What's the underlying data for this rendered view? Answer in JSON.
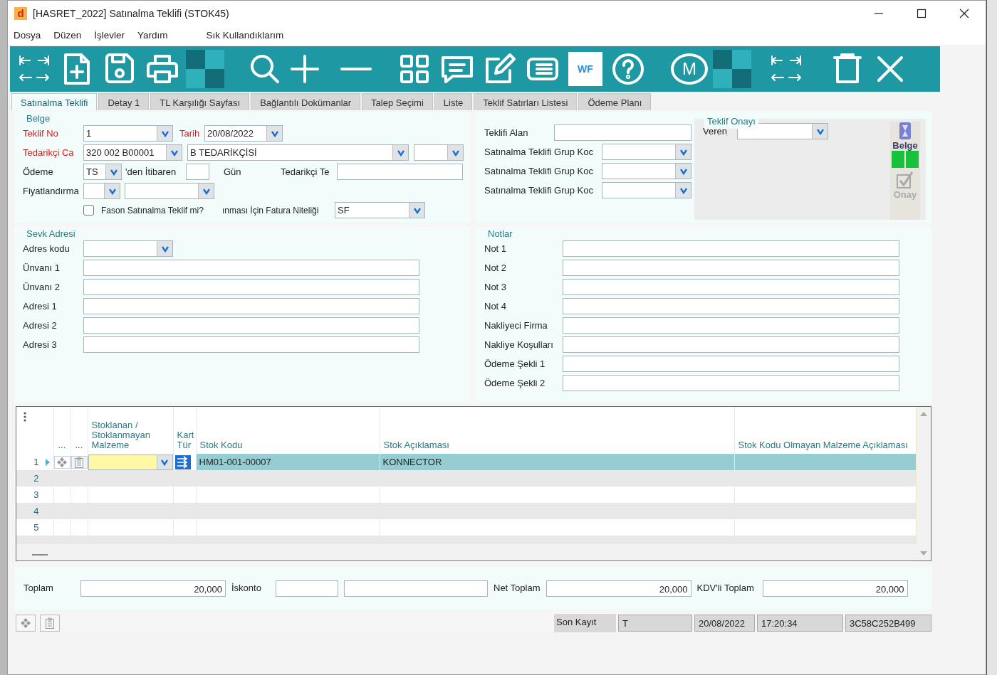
{
  "window": {
    "logo": "d",
    "title": "[HASRET_2022] Satınalma Teklifi (STOK45)"
  },
  "menu": [
    "Dosya",
    "Düzen",
    "İşlevler",
    "Yardım"
  ],
  "favorites_menu": "Sık Kullandıklarım",
  "toolbar": [
    {
      "kind": "nav"
    },
    {
      "kind": "new"
    },
    {
      "kind": "save"
    },
    {
      "kind": "print"
    },
    {
      "kind": "tile"
    },
    {
      "kind": "search"
    },
    {
      "kind": "add"
    },
    {
      "kind": "remove"
    },
    {
      "kind": "grid"
    },
    {
      "kind": "comment"
    },
    {
      "kind": "edit"
    },
    {
      "kind": "list"
    },
    {
      "kind": "badge",
      "label": "WF"
    },
    {
      "kind": "help"
    },
    {
      "kind": "circle",
      "label": "M"
    },
    {
      "kind": "tile"
    },
    {
      "kind": "nav2"
    },
    {
      "kind": "delete"
    },
    {
      "kind": "close"
    }
  ],
  "tabs": [
    {
      "label": "Satınalma Teklifi",
      "selected": true
    },
    {
      "label": "Detay 1",
      "selected": false
    },
    {
      "label": "TL Karşılığı Sayfası",
      "selected": false
    },
    {
      "label": "Bağlantılı Dokümanlar",
      "selected": false
    },
    {
      "label": "Talep Seçimi",
      "selected": false
    },
    {
      "label": "Liste",
      "selected": false
    },
    {
      "label": "Teklif Satırları Listesi",
      "selected": false
    },
    {
      "label": "Ödeme Planı",
      "selected": false
    }
  ],
  "belge": {
    "title": "Belge",
    "teklif_no": {
      "label": "Teklif No",
      "required": true,
      "value": "1"
    },
    "tarih": {
      "label": "Tarih",
      "required": true,
      "value": "20/08/2022"
    },
    "tedarikci": {
      "label": "Tedarikçi Ca",
      "required": true,
      "code": "320 002 B00001",
      "name": "B TEDARİKÇİSİ"
    },
    "odeme": {
      "label": "Ödeme",
      "required": false,
      "value": "TS",
      "from_label": "'den İtibaren",
      "days_label": "Gün",
      "supplier_label": "Tedarikçi Te"
    },
    "fiyatlandirma": {
      "label": "Fiyatlandırma",
      "required": false
    },
    "fason": {
      "label": "Fason Satınalma Teklif mi?",
      "checked": false
    },
    "fatura": {
      "label": "ınması İçin Fatura Niteliği",
      "value": "SF"
    }
  },
  "teklif_bilgi": {
    "teklifi_alan_label": "Teklifi Alan",
    "group_codes": [
      "Satınalma Teklifi Grup Koc",
      "Satınalma Teklifi Grup Koc",
      "Satınalma Teklifi Grup Koc"
    ]
  },
  "onay": {
    "title": "Teklif Onayı",
    "veren_label": "Veren",
    "belge_button": "Belge",
    "onay_button": {
      "label": "Onay",
      "disabled": true
    }
  },
  "sevk": {
    "title": "Sevk Adresi",
    "adres_kodu_label": "Adres kodu",
    "fields": [
      "Ünvanı 1",
      "Ünvanı 2",
      "Adresi 1",
      "Adresi 2",
      "Adresi 3"
    ]
  },
  "notlar": {
    "title": "Notlar",
    "fields": [
      "Not 1",
      "Not 2",
      "Not 3",
      "Not 4",
      "Nakliyeci Firma",
      "Nakliye Koşulları",
      "Ödeme Şekli 1",
      "Ödeme Şekli 2"
    ]
  },
  "grid": {
    "columns": [
      "...",
      "...",
      "Stoklanan / Stoklanmayan Malzeme",
      "Kart Tür",
      "Stok Kodu",
      "Stok Açıklaması",
      "Stok Kodu Olmayan Malzeme Açıklaması"
    ],
    "rows": [
      {
        "number": "1",
        "selected": true,
        "editing": true,
        "stock_code": "HM01-001-00007",
        "stock_description": "KONNECTOR"
      },
      {
        "number": "2",
        "selected": false,
        "editing": false
      },
      {
        "number": "3",
        "selected": false,
        "editing": false
      },
      {
        "number": "4",
        "selected": false,
        "editing": false
      },
      {
        "number": "5",
        "selected": false,
        "editing": false
      }
    ]
  },
  "totals": [
    {
      "kind": "single",
      "label": "Toplam",
      "value": "20,000"
    },
    {
      "kind": "pair",
      "label": "İskonto"
    },
    {
      "kind": "single",
      "label": "Net Toplam",
      "value": "20,000"
    },
    {
      "kind": "single",
      "label": "KDV'li Toplam",
      "value": "20,000"
    }
  ],
  "status": {
    "label": "Son Kayıt",
    "values": [
      "T",
      "20/08/2022",
      "17:20:34",
      "3C58C252B499"
    ]
  }
}
